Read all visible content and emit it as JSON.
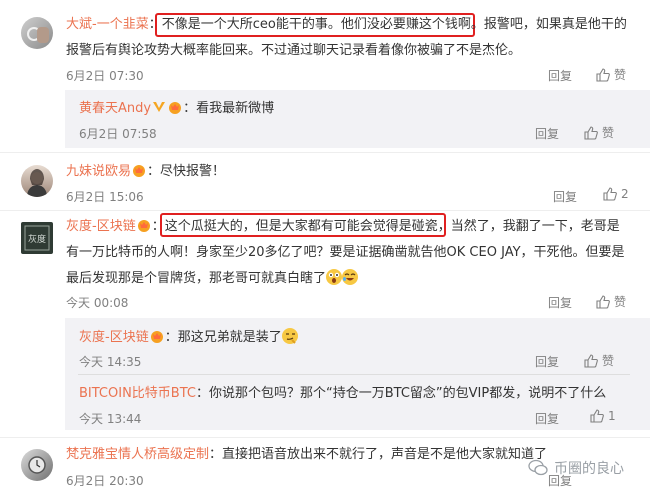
{
  "comments": [
    {
      "user": "大斌-一个韭菜",
      "sep": "：",
      "highlight": "不像是一个大所ceo能干的事。他们没必要赚这个钱啊。",
      "rest1": "报警吧，如果真是他干的",
      "line2": "报警后有舆论攻势大概率能回来。不过通过聊天记录看着像你被骗了不是杰伦。",
      "time": "6月2日 07:30",
      "reply": "回复",
      "like": "赞",
      "replies": [
        {
          "user": "黄春天Andy",
          "text": "：看我最新微博",
          "time": "6月2日 07:58",
          "reply": "回复",
          "like": "赞"
        }
      ]
    },
    {
      "user": "九妹说欧易",
      "text": "：尽快报警！",
      "time": "6月2日 15:06",
      "reply": "回复",
      "like_count": "2"
    },
    {
      "user": "灰度-区块链",
      "sep": "：",
      "highlight": "这个瓜挺大的，但是大家都有可能会觉得是碰瓷",
      "rest1": "，当然了，我翻了一下，老哥是",
      "line2": "有一万比特币的人啊！身家至少20多亿了吧？要是证据确凿就告他OK CEO JAY，干死他。但要是",
      "line3": "最后发现那是个冒牌货，那老哥可就真白瞎了",
      "time": "今天 00:08",
      "reply": "回复",
      "like": "赞",
      "replies": [
        {
          "user": "灰度-区块链",
          "text": "：那这兄弟就是装了",
          "time": "今天 14:35",
          "reply": "回复",
          "like": "赞"
        },
        {
          "user": "BITCOIN比特币BTC",
          "text": "：你说那个包吗？那个“持仓一万BTC留念”的包VIP都发，说明不了什么",
          "time": "今天 13:44",
          "reply": "回复",
          "like_count": "1"
        }
      ]
    },
    {
      "user": "梵克雅宝情人桥高级定制",
      "text": "：直接把语音放出来不就行了，声音是不是他大家就知道了",
      "time": "6月2日 20:30",
      "reply": "回复"
    }
  ],
  "watermark": "币圈的良心",
  "colors": {
    "name": "#eb7350",
    "highlight_border": "#e02020",
    "reply_bg": "#f2f2f5"
  }
}
